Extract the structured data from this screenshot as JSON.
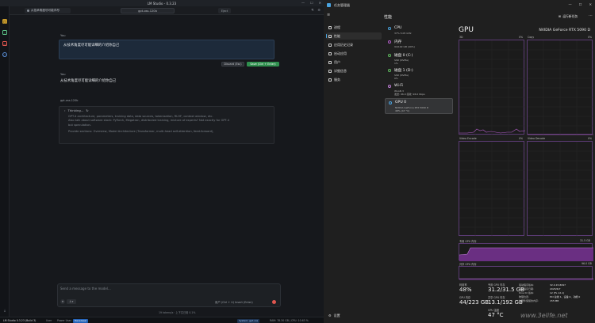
{
  "lm_studio": {
    "window_title": "LM Studio - 0.3.23",
    "tab_label": "从技术角度尽可能详尽",
    "model_selector": "gpt-oss-120b",
    "eject_label": "Eject",
    "user_label_1": "You",
    "edit_text": "从技术角度尽可能详细的介绍你自己",
    "discard_label": "Discard (Esc)",
    "save_label": "Save (Ctrl + Enter)",
    "user_label_2": "You",
    "user_message": "从技术角度尽可能详细的介绍你自己",
    "assistant_label": "gpt-oss-120b",
    "thinking_label": "Thinking...",
    "thinking_lines": [
      "GPT-4 architecture, parameters, training data, data sources, tokenization, RLHF, context window, etc.",
      "Also talk about software stack: PyTorch, Megatron, distributed training, mixture of experts? Not exactly for GPT-4",
      "but speculation.",
      "Provide sections: Overview, Model Architecture (Transformer, multi-head self-attention, feed-forward),"
    ],
    "input_placeholder": "Send a message to the model...",
    "mode_label": "Δ ▾",
    "send_hint": "用户 (Ctrl + U)      Insert (Enter)",
    "stats_text": "19 tokens/s · 上下文已用 0.1%",
    "statusbar": {
      "version": "LM Studio 0.3.23 (Build 3)",
      "user": "User",
      "power_user": "Power User",
      "developer": "Developer",
      "ram_chip": "System: gpt-oss",
      "resources": "RAM: 78.30 GB | CPU: 10.63 %"
    }
  },
  "task_manager": {
    "window_title": "任务管理器",
    "page_title": "性能",
    "run_task_label": "运行新任务",
    "nav": [
      "进程",
      "性能",
      "应用历史记录",
      "启动应用",
      "用户",
      "详细信息",
      "服务"
    ],
    "settings_label": "设置",
    "devices": [
      {
        "name": "CPU",
        "sub": "37% 5.05 GHz",
        "sub2": "",
        "color": "#4aa3df"
      },
      {
        "name": "内存",
        "sub": "94/192 GB (49%)",
        "sub2": "",
        "color": "#b05cc6"
      },
      {
        "name": "磁盘 0 (C:)",
        "sub": "SSD (NVMe)",
        "sub2": "1%",
        "color": "#5eb85e"
      },
      {
        "name": "磁盘 1 (D:)",
        "sub": "SSD (NVMe)",
        "sub2": "0%",
        "color": "#5eb85e"
      },
      {
        "name": "Wi-Fi",
        "sub": "WLAN 3",
        "sub2": "发送: 96.0 接收: 96.0 Kbps",
        "color": "#c07fd8"
      },
      {
        "name": "GPU 0",
        "sub": "NVIDIA GeForce RTX 5090 D",
        "sub2": "48% (47 °C)",
        "color": "#4aa3df"
      }
    ],
    "gpu_title": "GPU",
    "gpu_name": "NVIDIA GeForce RTX 5090 D",
    "graphs": {
      "g3d": {
        "label": "3D",
        "pct": "0%",
        "line_pct": "0%"
      },
      "copy": {
        "label": "Copy",
        "pct": "0%"
      },
      "venc": {
        "label": "Video Encode",
        "pct": "0%"
      },
      "vdec": {
        "label": "Video Decode",
        "pct": "0%"
      },
      "dedicated_label": "专用 GPU 内存",
      "dedicated_max": "31.5 GB",
      "shared_label": "共享 GPU 内存",
      "shared_max": "96.0 GB",
      "dedicated_level": 0.78
    },
    "stats": {
      "util_label": "利用率",
      "util_value": "48%",
      "ded_label": "专用 GPU 内存",
      "ded_value": "31.2/31.5 GB",
      "gpu_mem_label": "GPU 内存",
      "gpu_mem_value": "44/223 GB",
      "shared_label": "共享 GPU 内存",
      "shared_value": "13.1/192 GB",
      "temp_label": "GPU 温度",
      "temp_value": "47 °C"
    },
    "driver": {
      "labels": [
        "驱动程序版本:",
        "驱动程序日期:",
        "DirectX 版本:",
        "物理位置:",
        "为硬件保留的内存:"
      ],
      "values": [
        "32.0.15.8097",
        "2025/6/7",
        "12 (FL 12.1)",
        "PCI 总线 1、设备 0、功能 0",
        "155 MB"
      ]
    }
  },
  "watermark": "www.3elife.net"
}
